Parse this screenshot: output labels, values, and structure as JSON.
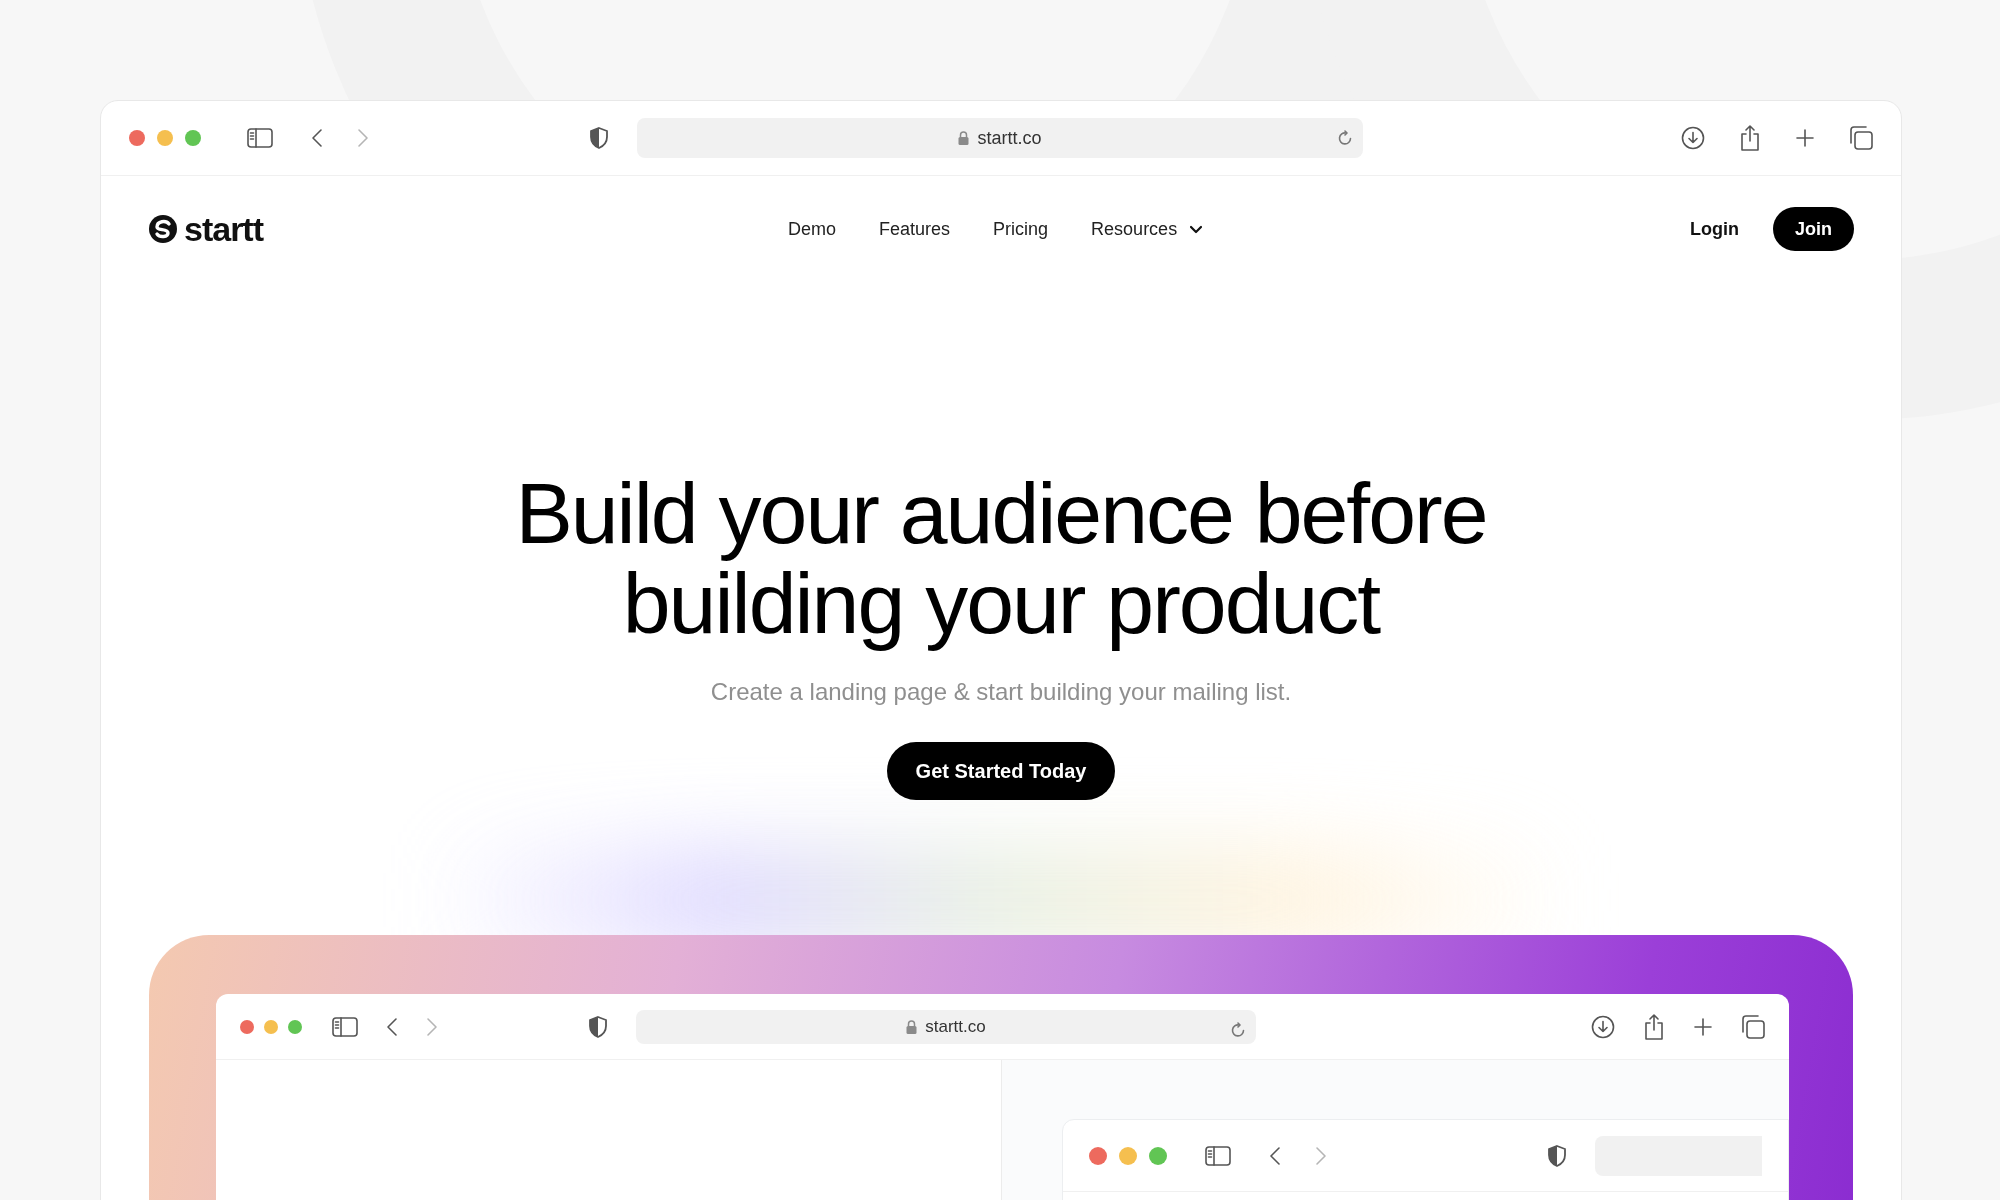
{
  "browser": {
    "url": "startt.co"
  },
  "site": {
    "logo": "startt",
    "nav": [
      {
        "label": "Demo",
        "dropdown": false
      },
      {
        "label": "Features",
        "dropdown": false
      },
      {
        "label": "Pricing",
        "dropdown": false
      },
      {
        "label": "Resources",
        "dropdown": true
      }
    ],
    "login": "Login",
    "join": "Join"
  },
  "hero": {
    "headline_lines": [
      "Build your audience before",
      "building your product"
    ],
    "subtitle": "Create a landing page & start building your mailing list.",
    "cta": "Get Started Today"
  },
  "preview": {
    "browser": {
      "url": "startt.co"
    }
  }
}
